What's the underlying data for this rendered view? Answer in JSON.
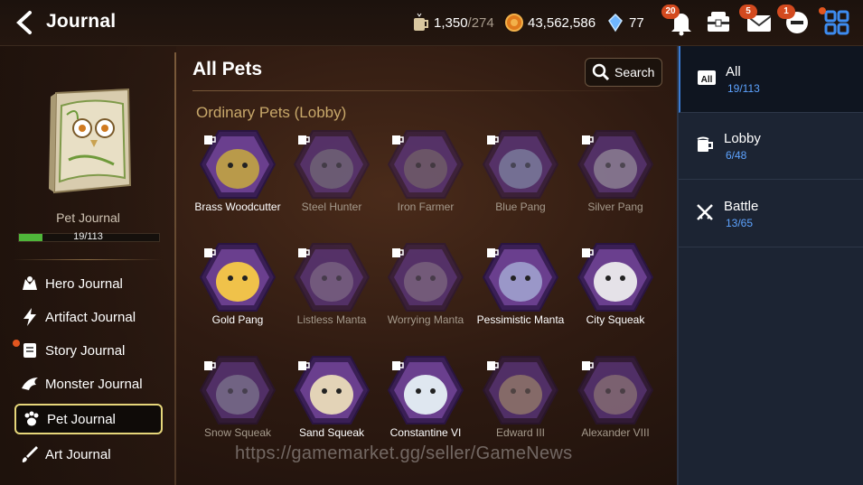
{
  "header": {
    "title": "Journal",
    "resources": [
      {
        "icon": "stamina-icon",
        "value": "1,350",
        "sub": "/274"
      },
      {
        "icon": "gold-icon",
        "value": "43,562,586",
        "sub": ""
      },
      {
        "icon": "crystal-icon",
        "value": "77",
        "sub": ""
      }
    ],
    "badges": {
      "notifications": "20",
      "mail": "5",
      "chat": "1"
    }
  },
  "sidebar": {
    "pet_journal_label": "Pet Journal",
    "progress_text": "19/113",
    "progress": 0.168,
    "items": [
      {
        "label": "Hero Journal"
      },
      {
        "label": "Artifact Journal"
      },
      {
        "label": "Story Journal"
      },
      {
        "label": "Monster Journal"
      },
      {
        "label": "Pet Journal"
      },
      {
        "label": "Art Journal"
      }
    ]
  },
  "main": {
    "heading": "All Pets",
    "search_label": "Search",
    "section": "Ordinary Pets (Lobby)",
    "pets": [
      {
        "name": "Brass Woodcutter",
        "owned": true,
        "color": "#b99a4a"
      },
      {
        "name": "Steel Hunter",
        "owned": false,
        "color": "#7d7d7d"
      },
      {
        "name": "Iron Farmer",
        "owned": false,
        "color": "#7d7268"
      },
      {
        "name": "Blue Pang",
        "owned": false,
        "color": "#8ea3b8"
      },
      {
        "name": "Silver Pang",
        "owned": false,
        "color": "#a9a9a9"
      },
      {
        "name": "Gold Pang",
        "owned": true,
        "color": "#f0c24a"
      },
      {
        "name": "Listless Manta",
        "owned": false,
        "color": "#8a7a8e"
      },
      {
        "name": "Worrying Manta",
        "owned": false,
        "color": "#8c7b88"
      },
      {
        "name": "Pessimistic Manta",
        "owned": true,
        "color": "#9a97c8"
      },
      {
        "name": "City Squeak",
        "owned": true,
        "color": "#e5e2e8"
      },
      {
        "name": "Snow Squeak",
        "owned": false,
        "color": "#8d8e9a"
      },
      {
        "name": "Sand Squeak",
        "owned": true,
        "color": "#e3d3b7"
      },
      {
        "name": "Constantine VI",
        "owned": true,
        "color": "#dfe7f0"
      },
      {
        "name": "Edward III",
        "owned": false,
        "color": "#b09a6a"
      },
      {
        "name": "Alexander VIII",
        "owned": false,
        "color": "#9e8a78"
      }
    ]
  },
  "tabs": [
    {
      "label": "All",
      "count": "19/113"
    },
    {
      "label": "Lobby",
      "count": "6/48"
    },
    {
      "label": "Battle",
      "count": "13/65"
    }
  ],
  "watermark": "https://gamemarket.gg/seller/GameNews"
}
